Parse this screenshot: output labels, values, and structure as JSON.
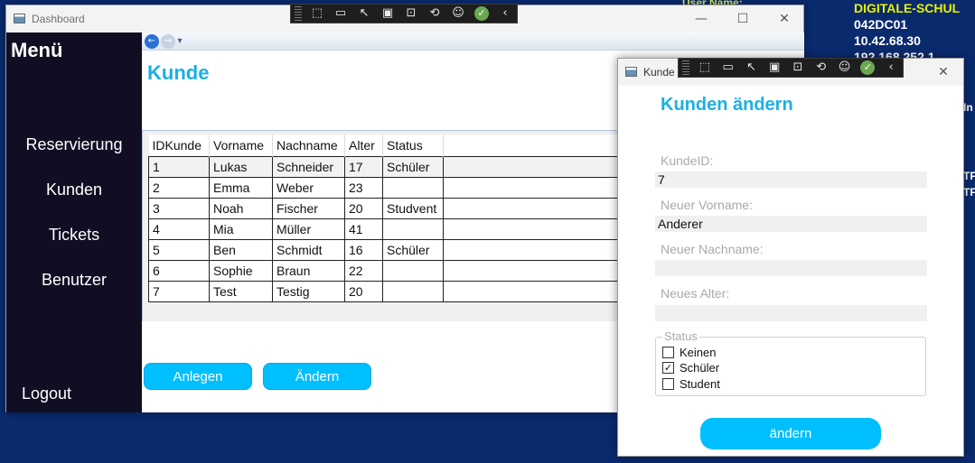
{
  "desktop": {
    "username_partial": "User Name:",
    "info_lines": [
      "DIGITALE-SCHUL",
      "042DC01",
      "10.42.68.30",
      "192.168.252.1"
    ],
    "edge_fragments": [
      "TF",
      "TF",
      "In"
    ]
  },
  "main_window": {
    "title": "Dashboard",
    "controls": {
      "minimize": "—",
      "maximize": "☐",
      "close": "✕"
    },
    "sidebar": {
      "title": "Menü",
      "items": [
        {
          "label": "Reservierung"
        },
        {
          "label": "Kunden"
        },
        {
          "label": "Tickets"
        },
        {
          "label": "Benutzer"
        }
      ],
      "logout": "Logout"
    },
    "nav": {
      "back": "←",
      "forward": "→",
      "dropdown": "▾"
    },
    "page_title": "Kunde",
    "table": {
      "columns": [
        "IDKunde",
        "Vorname",
        "Nachname",
        "Alter",
        "Status"
      ],
      "rows": [
        [
          "1",
          "Lukas",
          "Schneider",
          "17",
          "Schüler"
        ],
        [
          "2",
          "Emma",
          "Weber",
          "23",
          ""
        ],
        [
          "3",
          "Noah",
          "Fischer",
          "20",
          "Studvent"
        ],
        [
          "4",
          "Mia",
          "Müller",
          "41",
          ""
        ],
        [
          "5",
          "Ben",
          "Schmidt",
          "16",
          "Schüler"
        ],
        [
          "6",
          "Sophie",
          "Braun",
          "22",
          ""
        ],
        [
          "7",
          "Test",
          "Testig",
          "20",
          ""
        ]
      ]
    },
    "buttons": {
      "create": "Anlegen",
      "edit": "Ändern"
    }
  },
  "debug_toolbar": {
    "icons": [
      "select-element-icon",
      "record-icon",
      "pointer-icon",
      "frame-icon",
      "hot-reload-icon",
      "binding-icon",
      "accessibility-icon",
      "check-ok-icon",
      "collapse-icon"
    ]
  },
  "dialog": {
    "title": "Kunde",
    "controls": {
      "close": "✕"
    },
    "heading": "Kunden ändern",
    "fields": {
      "id": {
        "label": "KundeID:",
        "value": "7"
      },
      "first_name": {
        "label": "Neuer Vorname:",
        "value": "Anderer"
      },
      "last_name": {
        "label": "Neuer Nachname:",
        "value": ""
      },
      "age": {
        "label": "Neues Alter:",
        "value": ""
      }
    },
    "status": {
      "legend": "Status",
      "options": [
        {
          "label": "Keinen",
          "checked": false
        },
        {
          "label": "Schüler",
          "checked": true
        },
        {
          "label": "Student",
          "checked": false
        }
      ]
    },
    "submit": "ändern"
  },
  "colors": {
    "accent": "#00bfff",
    "title_blue": "#1ab0e6",
    "sidebar_bg": "#110e24",
    "checked_ok": "#6aa84f"
  }
}
